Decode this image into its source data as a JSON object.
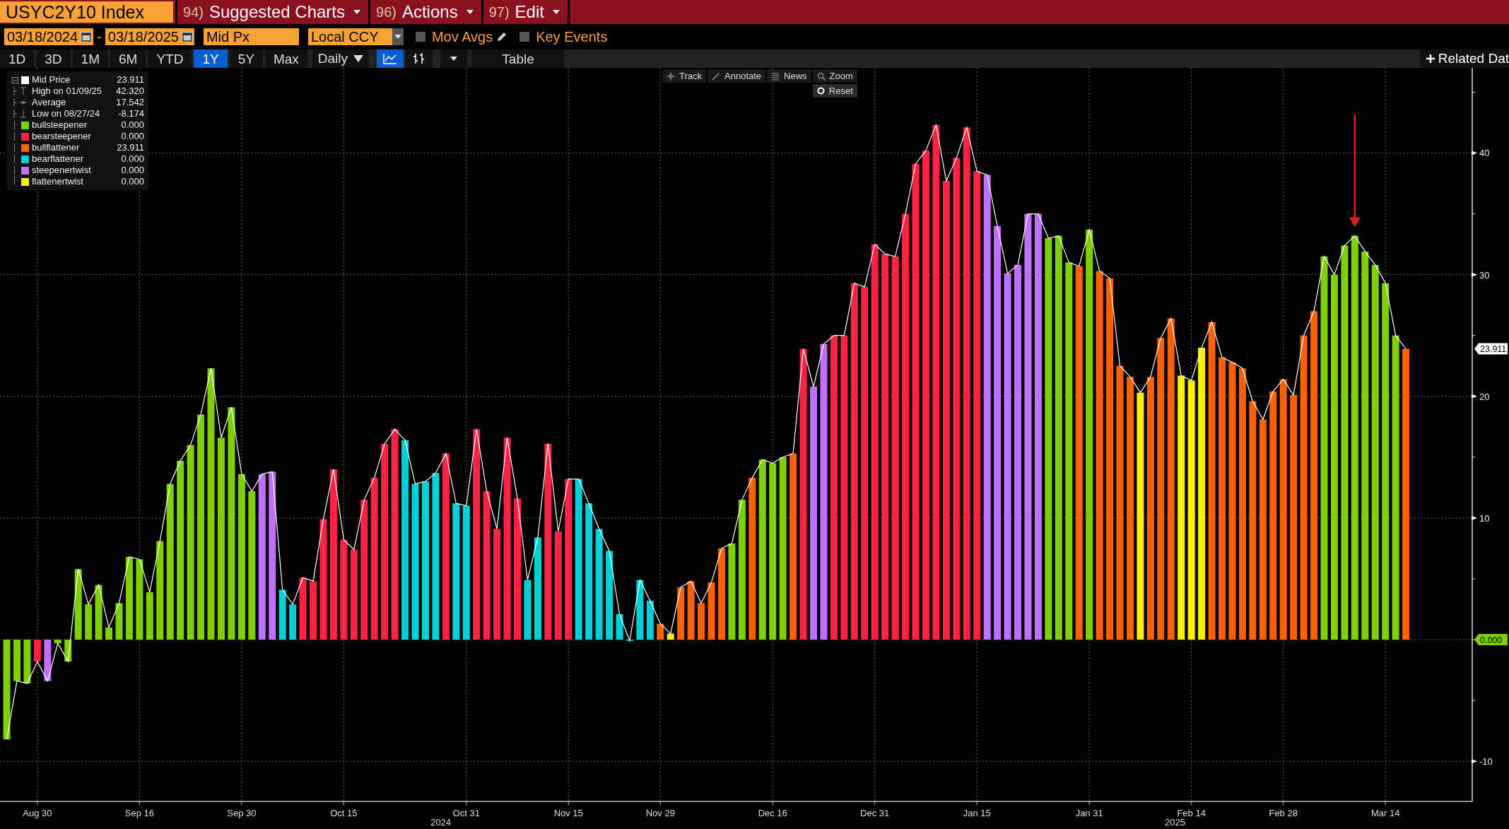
{
  "header": {
    "ticker": "USYC2Y10 Index",
    "menus": [
      {
        "number": "94)",
        "label": "Suggested Charts"
      },
      {
        "number": "96)",
        "label": "Actions"
      },
      {
        "number": "97)",
        "label": "Edit"
      }
    ]
  },
  "settings": {
    "start_date": "03/18/2024",
    "separator": "-",
    "end_date": "03/18/2025",
    "field": "Mid Px",
    "currency": "Local CCY",
    "options": [
      {
        "label": "Mov Avgs",
        "checked": false,
        "kind": "editable"
      },
      {
        "label": "Key Events",
        "checked": false,
        "kind": "plain"
      }
    ]
  },
  "periods": [
    {
      "label": "1D",
      "selected": false
    },
    {
      "label": "3D",
      "selected": false
    },
    {
      "label": "1M",
      "selected": false
    },
    {
      "label": "6M",
      "selected": false
    },
    {
      "label": "YTD",
      "selected": false
    },
    {
      "label": "1Y",
      "selected": true
    },
    {
      "label": "5Y",
      "selected": false
    },
    {
      "label": "Max",
      "selected": false
    }
  ],
  "frequency": "Daily",
  "chart_styles": [
    {
      "kind": "line",
      "selected": true
    },
    {
      "kind": "bars",
      "selected": false
    }
  ],
  "table_button": "Table",
  "related_data": "Related Dat",
  "chart_tools": [
    {
      "kind": "track",
      "label": "Track"
    },
    {
      "kind": "annotate",
      "label": "Annotate"
    },
    {
      "kind": "news",
      "label": "News"
    },
    {
      "kind": "zoom",
      "label": "Zoom"
    }
  ],
  "reset_button": "Reset",
  "legend": [
    {
      "kind": "series",
      "value": "23.911"
    },
    {
      "kind": "high",
      "label": "High on 01/09/25",
      "value": "42.320"
    },
    {
      "kind": "average",
      "label": "Average",
      "value": "17.542"
    },
    {
      "kind": "low",
      "label": "Low on 08/27/24",
      "value": "-8.174"
    },
    {
      "kind": "regime",
      "value": "0.000"
    },
    {
      "kind": "regime",
      "value": "0.000"
    },
    {
      "kind": "regime",
      "value": "23.911"
    },
    {
      "kind": "regime",
      "value": "0.000"
    },
    {
      "kind": "regime",
      "value": "0.000"
    },
    {
      "kind": "regime",
      "value": "0.000"
    }
  ],
  "chart_data": {
    "type": "bar",
    "grid": true,
    "ylim": [
      -13.3,
      47
    ],
    "categories": [
      null,
      null,
      null,
      "Aug 30",
      null,
      null,
      null,
      null,
      null,
      null,
      null,
      null,
      null,
      "Sep 16",
      null,
      null,
      null,
      null,
      null,
      null,
      null,
      null,
      null,
      "Sep 30",
      null,
      null,
      null,
      null,
      null,
      null,
      null,
      null,
      null,
      "Oct 15",
      null,
      null,
      null,
      null,
      null,
      null,
      null,
      null,
      null,
      null,
      null,
      "Oct 31",
      null,
      null,
      null,
      null,
      null,
      null,
      null,
      null,
      null,
      "Nov 15",
      null,
      null,
      null,
      null,
      null,
      null,
      null,
      null,
      "Nov 29",
      null,
      null,
      null,
      null,
      null,
      null,
      null,
      null,
      null,
      null,
      "Dec 16",
      null,
      null,
      null,
      null,
      null,
      null,
      null,
      null,
      null,
      "Dec 31",
      null,
      null,
      null,
      null,
      null,
      null,
      null,
      null,
      null,
      "Jan 15",
      null,
      null,
      null,
      null,
      null,
      null,
      null,
      null,
      null,
      null,
      "Jan 31",
      null,
      null,
      null,
      null,
      null,
      null,
      null,
      null,
      null,
      "Feb 14",
      null,
      null,
      null,
      null,
      null,
      null,
      null,
      null,
      "Feb 28",
      null,
      null,
      null,
      null,
      null,
      null,
      null,
      null,
      null,
      "Mar 14",
      null,
      null
    ],
    "series": [
      {
        "name": "Mid Price",
        "color": "#ffffff",
        "type": "line",
        "values": [
          -8.2,
          -3.4,
          -3.6,
          -1.8,
          -3.4,
          -0.3,
          -1.8,
          5.8,
          2.9,
          4.5,
          1.0,
          3.0,
          6.8,
          6.6,
          3.9,
          8.1,
          12.8,
          14.7,
          16.0,
          18.5,
          22.3,
          16.6,
          19.1,
          13.6,
          12.2,
          13.6,
          13.8,
          4.1,
          2.9,
          5.1,
          4.8,
          9.9,
          14.0,
          8.2,
          7.4,
          11.5,
          13.3,
          16.1,
          17.3,
          16.4,
          12.8,
          13.0,
          13.7,
          15.3,
          11.2,
          11.0,
          17.3,
          12.2,
          9.1,
          16.6,
          11.6,
          4.9,
          8.4,
          16.1,
          8.9,
          13.2,
          13.2,
          11.2,
          9.1,
          7.3,
          2.1,
          -0.1,
          4.9,
          3.2,
          1.3,
          0.5,
          4.3,
          4.8,
          3.0,
          4.7,
          7.5,
          7.9,
          11.5,
          13.3,
          14.8,
          14.5,
          15.0,
          15.3,
          23.9,
          20.8,
          24.3,
          25.0,
          25.0,
          29.3,
          29.0,
          32.5,
          31.7,
          31.5,
          35.0,
          39.1,
          40.2,
          42.3,
          37.7,
          39.6,
          42.1,
          38.5,
          38.2,
          34.0,
          30.1,
          30.8,
          35.0,
          35.0,
          33.0,
          33.2,
          31.0,
          30.7,
          33.7,
          30.3,
          29.7,
          22.5,
          21.6,
          20.3,
          21.6,
          24.8,
          26.4,
          21.7,
          21.3,
          24.0,
          26.1,
          23.2,
          22.8,
          22.3,
          19.6,
          18.1,
          20.4,
          21.4,
          20.1,
          25.0,
          27.0,
          31.5,
          30.0,
          32.4,
          33.2,
          31.9,
          30.8,
          29.3,
          25.0,
          23.911
        ]
      },
      {
        "name": "bullsteepener",
        "color": "#7ed000",
        "values": [
          -8.2,
          -3.4,
          -3.6,
          null,
          null,
          -0.3,
          -1.8,
          5.8,
          2.9,
          4.5,
          1.0,
          3.0,
          6.8,
          6.6,
          3.9,
          8.1,
          12.8,
          14.7,
          16.0,
          18.5,
          22.3,
          16.6,
          19.1,
          13.6,
          12.2,
          null,
          null,
          null,
          null,
          null,
          null,
          null,
          null,
          null,
          null,
          null,
          null,
          null,
          null,
          null,
          null,
          null,
          null,
          null,
          null,
          null,
          null,
          null,
          null,
          null,
          null,
          null,
          null,
          null,
          null,
          null,
          null,
          null,
          null,
          null,
          null,
          null,
          null,
          null,
          null,
          null,
          null,
          null,
          null,
          null,
          null,
          7.9,
          11.5,
          null,
          14.8,
          14.5,
          15.0,
          null,
          null,
          null,
          null,
          null,
          null,
          null,
          null,
          null,
          null,
          null,
          null,
          null,
          null,
          null,
          null,
          null,
          null,
          null,
          null,
          null,
          null,
          null,
          null,
          null,
          33.0,
          33.2,
          31.0,
          null,
          33.7,
          null,
          null,
          null,
          null,
          null,
          null,
          null,
          null,
          null,
          null,
          null,
          null,
          null,
          null,
          null,
          null,
          null,
          null,
          null,
          null,
          null,
          null,
          31.5,
          30.0,
          32.4,
          33.2,
          31.9,
          30.8,
          29.3,
          25.0,
          null
        ]
      },
      {
        "name": "bearsteepener",
        "color": "#ff2244",
        "values": [
          null,
          null,
          null,
          -1.8,
          null,
          null,
          null,
          null,
          null,
          null,
          null,
          null,
          null,
          null,
          null,
          null,
          null,
          null,
          null,
          null,
          null,
          null,
          null,
          null,
          null,
          null,
          null,
          null,
          null,
          5.1,
          4.8,
          9.9,
          14.0,
          8.2,
          7.4,
          11.5,
          13.3,
          16.1,
          17.3,
          null,
          null,
          null,
          null,
          15.3,
          null,
          null,
          17.3,
          12.2,
          9.1,
          16.6,
          11.6,
          null,
          null,
          16.1,
          8.9,
          13.2,
          null,
          null,
          null,
          null,
          null,
          null,
          null,
          null,
          null,
          null,
          null,
          null,
          null,
          null,
          null,
          null,
          null,
          null,
          null,
          null,
          null,
          null,
          23.9,
          null,
          null,
          25.0,
          25.0,
          29.3,
          29.0,
          32.5,
          31.7,
          31.5,
          35.0,
          39.1,
          40.2,
          42.3,
          37.7,
          39.6,
          42.1,
          38.5,
          null,
          null,
          null,
          null,
          null,
          null,
          null,
          null,
          null,
          null,
          null,
          null,
          null,
          null,
          null,
          null,
          null,
          null,
          null,
          null,
          null,
          null,
          null,
          null,
          null,
          null,
          null,
          null,
          null,
          null,
          null,
          null,
          null,
          null,
          null,
          null,
          null,
          null,
          null,
          null,
          null,
          null
        ]
      },
      {
        "name": "bullflattener",
        "color": "#ff6000",
        "values": [
          null,
          null,
          null,
          null,
          null,
          null,
          null,
          null,
          null,
          null,
          null,
          null,
          null,
          null,
          null,
          null,
          null,
          null,
          null,
          null,
          null,
          null,
          null,
          null,
          null,
          null,
          null,
          null,
          null,
          null,
          null,
          null,
          null,
          null,
          null,
          null,
          null,
          null,
          null,
          null,
          null,
          null,
          null,
          null,
          null,
          null,
          null,
          null,
          null,
          null,
          null,
          null,
          null,
          null,
          null,
          null,
          null,
          null,
          null,
          null,
          null,
          null,
          null,
          null,
          1.3,
          null,
          4.3,
          4.8,
          3.0,
          4.7,
          7.5,
          null,
          null,
          13.3,
          null,
          null,
          null,
          15.3,
          null,
          null,
          null,
          null,
          null,
          null,
          null,
          null,
          null,
          null,
          null,
          null,
          null,
          null,
          null,
          null,
          null,
          null,
          null,
          null,
          null,
          null,
          null,
          null,
          null,
          null,
          null,
          30.7,
          null,
          30.3,
          29.7,
          22.5,
          21.6,
          null,
          21.6,
          24.8,
          26.4,
          null,
          null,
          null,
          26.1,
          23.2,
          22.8,
          22.3,
          19.6,
          18.1,
          20.4,
          21.4,
          20.1,
          25.0,
          27.0,
          null,
          null,
          null,
          null,
          null,
          null,
          null,
          null,
          23.911
        ]
      },
      {
        "name": "bearflattener",
        "color": "#00d0d8",
        "values": [
          null,
          null,
          null,
          null,
          null,
          null,
          null,
          null,
          null,
          null,
          null,
          null,
          null,
          null,
          null,
          null,
          null,
          null,
          null,
          null,
          null,
          null,
          null,
          null,
          null,
          null,
          null,
          4.1,
          2.9,
          null,
          null,
          null,
          null,
          null,
          null,
          null,
          null,
          null,
          null,
          16.4,
          12.8,
          13.0,
          13.7,
          null,
          11.2,
          11.0,
          null,
          null,
          null,
          null,
          null,
          4.9,
          8.4,
          null,
          null,
          null,
          13.2,
          11.2,
          9.1,
          7.3,
          2.1,
          -0.1,
          4.9,
          3.2,
          null,
          null,
          null,
          null,
          null,
          null,
          null,
          null,
          null,
          null,
          null,
          null,
          null,
          null,
          null,
          null,
          null,
          null,
          null,
          null,
          null,
          null,
          null,
          null,
          null,
          null,
          null,
          null,
          null,
          null,
          null,
          null,
          null,
          null,
          null,
          null,
          null,
          null,
          null,
          null,
          null,
          null,
          null,
          null,
          null,
          null,
          null,
          null,
          null,
          null,
          null,
          null,
          null,
          null,
          null,
          null,
          null,
          null,
          null,
          null,
          null,
          null,
          null,
          null,
          null,
          null,
          null,
          null,
          null,
          null,
          null,
          null,
          null,
          null
        ]
      },
      {
        "name": "steepenertwist",
        "color": "#c070ff",
        "values": [
          null,
          null,
          null,
          null,
          -3.4,
          null,
          null,
          null,
          null,
          null,
          null,
          null,
          null,
          null,
          null,
          null,
          null,
          null,
          null,
          null,
          null,
          null,
          null,
          null,
          null,
          13.6,
          13.8,
          null,
          null,
          null,
          null,
          null,
          null,
          null,
          null,
          null,
          null,
          null,
          null,
          null,
          null,
          null,
          null,
          null,
          null,
          null,
          null,
          null,
          null,
          null,
          null,
          null,
          null,
          null,
          null,
          null,
          null,
          null,
          null,
          null,
          null,
          null,
          null,
          null,
          null,
          null,
          null,
          null,
          null,
          null,
          null,
          null,
          null,
          null,
          null,
          null,
          null,
          null,
          null,
          20.8,
          24.3,
          null,
          null,
          null,
          null,
          null,
          null,
          null,
          null,
          null,
          null,
          null,
          null,
          null,
          null,
          null,
          38.2,
          34.0,
          30.1,
          30.8,
          35.0,
          35.0,
          null,
          null,
          null,
          null,
          null,
          null,
          null,
          null,
          null,
          null,
          null,
          null,
          null,
          null,
          null,
          null,
          null,
          null,
          null,
          null,
          null,
          null,
          null,
          null,
          null,
          null,
          null,
          null,
          null,
          null,
          null,
          null,
          null,
          null,
          null,
          null
        ]
      },
      {
        "name": "flattenertwist",
        "color": "#ffee00",
        "values": [
          null,
          null,
          null,
          null,
          null,
          null,
          null,
          null,
          null,
          null,
          null,
          null,
          null,
          null,
          null,
          null,
          null,
          null,
          null,
          null,
          null,
          null,
          null,
          null,
          null,
          null,
          null,
          null,
          null,
          null,
          null,
          null,
          null,
          null,
          null,
          null,
          null,
          null,
          null,
          null,
          null,
          null,
          null,
          null,
          null,
          null,
          null,
          null,
          null,
          null,
          null,
          null,
          null,
          null,
          null,
          null,
          null,
          null,
          null,
          null,
          null,
          null,
          null,
          null,
          null,
          0.5,
          null,
          null,
          null,
          null,
          null,
          null,
          null,
          null,
          null,
          null,
          null,
          null,
          null,
          null,
          null,
          null,
          null,
          null,
          null,
          null,
          null,
          null,
          null,
          null,
          null,
          null,
          null,
          null,
          null,
          null,
          null,
          null,
          null,
          null,
          null,
          null,
          null,
          null,
          null,
          null,
          null,
          null,
          null,
          null,
          null,
          20.3,
          null,
          null,
          null,
          21.7,
          21.3,
          24.0,
          null,
          null,
          null,
          null,
          null,
          null,
          null,
          null,
          null,
          null,
          null,
          null,
          null,
          null,
          null,
          null,
          null,
          null,
          null,
          null
        ]
      }
    ],
    "yticks": [
      -10,
      {
        "value": 0,
        "label": "0.000"
      },
      10,
      20,
      30,
      40
    ],
    "annotations": [
      "2024",
      "2025",
      "23.911"
    ]
  },
  "arrow_marker": true
}
